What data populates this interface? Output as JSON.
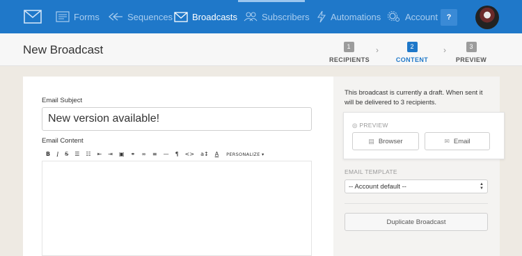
{
  "nav": {
    "items": [
      {
        "label": "Forms",
        "icon": "forms-icon"
      },
      {
        "label": "Sequences",
        "icon": "sequences-icon"
      },
      {
        "label": "Broadcasts",
        "icon": "broadcasts-icon",
        "active": true
      },
      {
        "label": "Subscribers",
        "icon": "subscribers-icon"
      },
      {
        "label": "Automations",
        "icon": "automations-icon"
      },
      {
        "label": "Account",
        "icon": "account-gear-icon"
      }
    ],
    "help_label": "?"
  },
  "header": {
    "title": "New Broadcast",
    "steps": [
      {
        "num": "1",
        "label": "RECIPIENTS"
      },
      {
        "num": "2",
        "label": "CONTENT",
        "active": true
      },
      {
        "num": "3",
        "label": "PREVIEW"
      }
    ]
  },
  "editor": {
    "subject_label": "Email Subject",
    "subject_value": "New version available!",
    "content_label": "Email Content",
    "toolbar": {
      "bold": "B",
      "italic": "I",
      "strike": "S",
      "bullet_list": "☰",
      "numbered_list": "☷",
      "outdent": "⇤",
      "indent": "⇥",
      "image": "▣",
      "link": "⚭",
      "unlink": "∞",
      "align": "≡",
      "hr": "—",
      "paragraph": "¶",
      "code": "<>",
      "font_size": "a↕",
      "text_color": "A",
      "personalize": "PERSONALIZE ▾"
    }
  },
  "sidebar": {
    "draft_text": "This broadcast is currently a draft. When sent it will be delivered to 3 recipients.",
    "preview_title": "PREVIEW",
    "browser_label": "Browser",
    "email_label": "Email",
    "template_label": "EMAIL TEMPLATE",
    "template_value": "-- Account default --",
    "duplicate_label": "Duplicate Broadcast"
  },
  "colors": {
    "nav_bg": "#1f78c9",
    "accent": "#1f78c9",
    "page_bg": "#eeeae3"
  }
}
